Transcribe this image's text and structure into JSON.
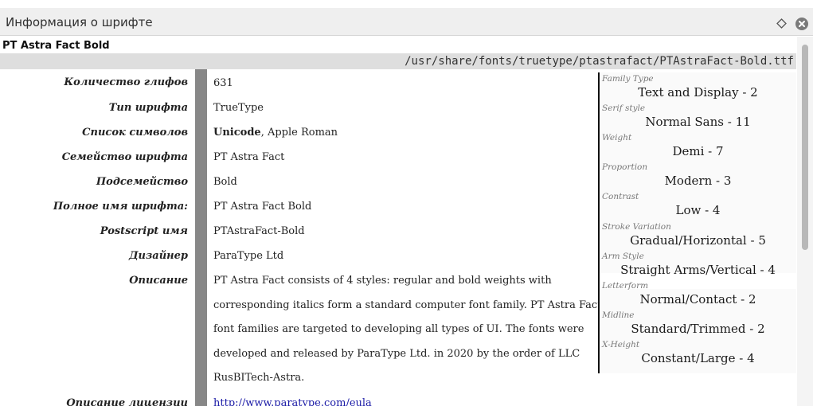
{
  "window": {
    "title": "Информация о шрифте",
    "icons": {
      "pin": "diamond-icon",
      "close": "close-icon"
    }
  },
  "font": {
    "name": "PT Astra Fact Bold",
    "path": "/usr/share/fonts/truetype/ptastrafact/PTAstraFact-Bold.ttf"
  },
  "rows": [
    {
      "label": "Количество глифов",
      "value": "631"
    },
    {
      "label": "Тип шрифта",
      "value": "TrueType"
    },
    {
      "label": "Список символов",
      "value_bold": "Unicode",
      "value": ", Apple Roman"
    },
    {
      "label": "Семейство шрифта",
      "value": "PT Astra Fact"
    },
    {
      "label": "Подсемейство",
      "value": "Bold"
    },
    {
      "label": "Полное имя шрифта:",
      "value": "PT Astra Fact Bold"
    },
    {
      "label": "Postscript имя",
      "value": "PTAstraFact-Bold"
    },
    {
      "label": "Дизайнер",
      "value": "ParaType Ltd"
    },
    {
      "label": "Описание",
      "value": ""
    }
  ],
  "description": [
    "PT Astra Fact consists of 4 styles: regular and bold weights with",
    "corresponding italics form a standard computer font family. PT Astra Fact",
    "font families are targeted to developing all types of UI. The fonts were",
    "developed and released by ParaType Ltd. in 2020 by the order of LLC",
    "RusBITech-Astra."
  ],
  "license": {
    "label": "Описание лицензии",
    "url": "http://www.paratype.com/eula"
  },
  "panose": [
    {
      "key": "Family Type",
      "value": "Text and Display - 2"
    },
    {
      "key": "Serif style",
      "value": "Normal Sans - 11"
    },
    {
      "key": "Weight",
      "value": "Demi - 7"
    },
    {
      "key": "Proportion",
      "value": "Modern - 3"
    },
    {
      "key": "Contrast",
      "value": "Low - 4"
    },
    {
      "key": "Stroke Variation",
      "value": "Gradual/Horizontal - 5"
    },
    {
      "key": "Arm Style",
      "value": "Straight Arms/Vertical - 4"
    },
    {
      "key": "Letterform",
      "value": "Normal/Contact - 2"
    },
    {
      "key": "Midline",
      "value": "Standard/Trimmed - 2"
    },
    {
      "key": "X-Height",
      "value": "Constant/Large - 4"
    }
  ]
}
